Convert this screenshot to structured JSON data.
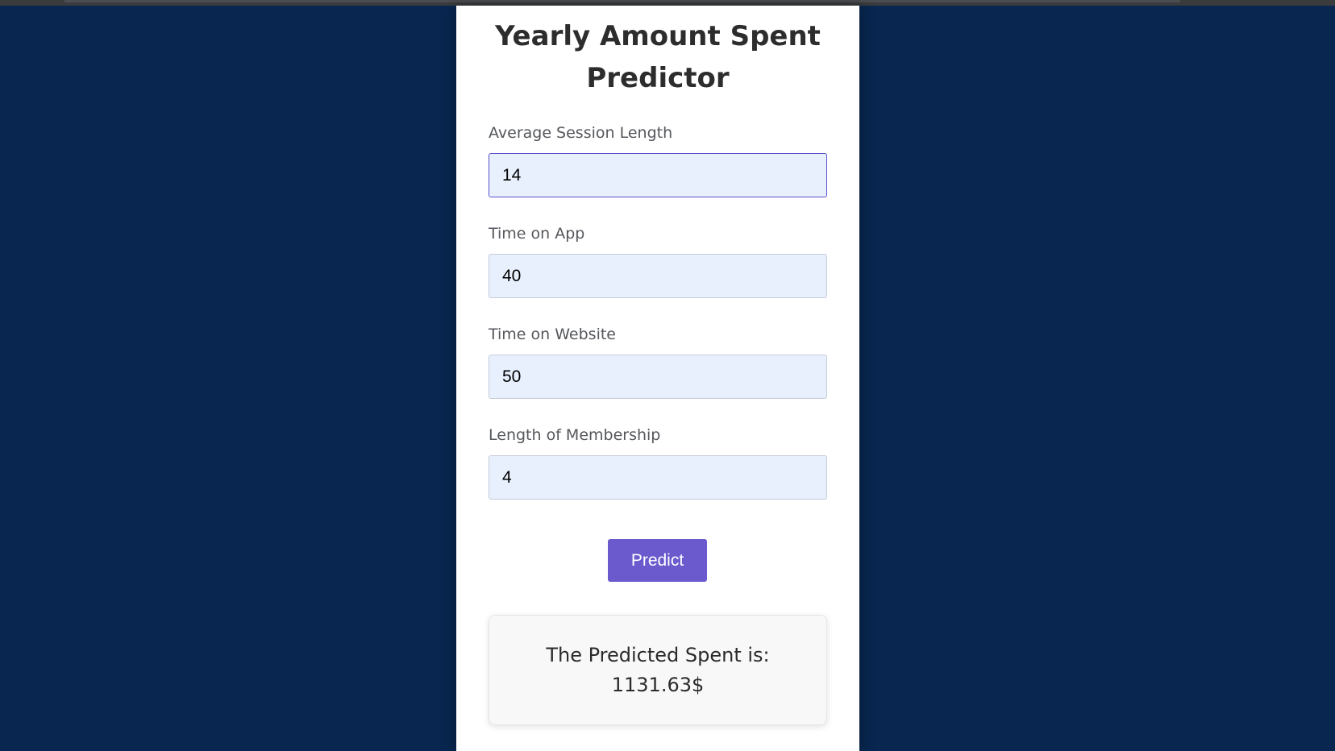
{
  "page": {
    "background_color": "#08264f",
    "accent_color": "#6a5acd"
  },
  "form": {
    "title": "Yearly Amount Spent Predictor",
    "fields": [
      {
        "label": "Average Session Length",
        "value": "14"
      },
      {
        "label": "Time on App",
        "value": "40"
      },
      {
        "label": "Time on Website",
        "value": "50"
      },
      {
        "label": "Length of Membership",
        "value": "4"
      }
    ],
    "predict_label": "Predict"
  },
  "result": {
    "prefix": "The Predicted Spent is:",
    "value": "1131.63$"
  }
}
